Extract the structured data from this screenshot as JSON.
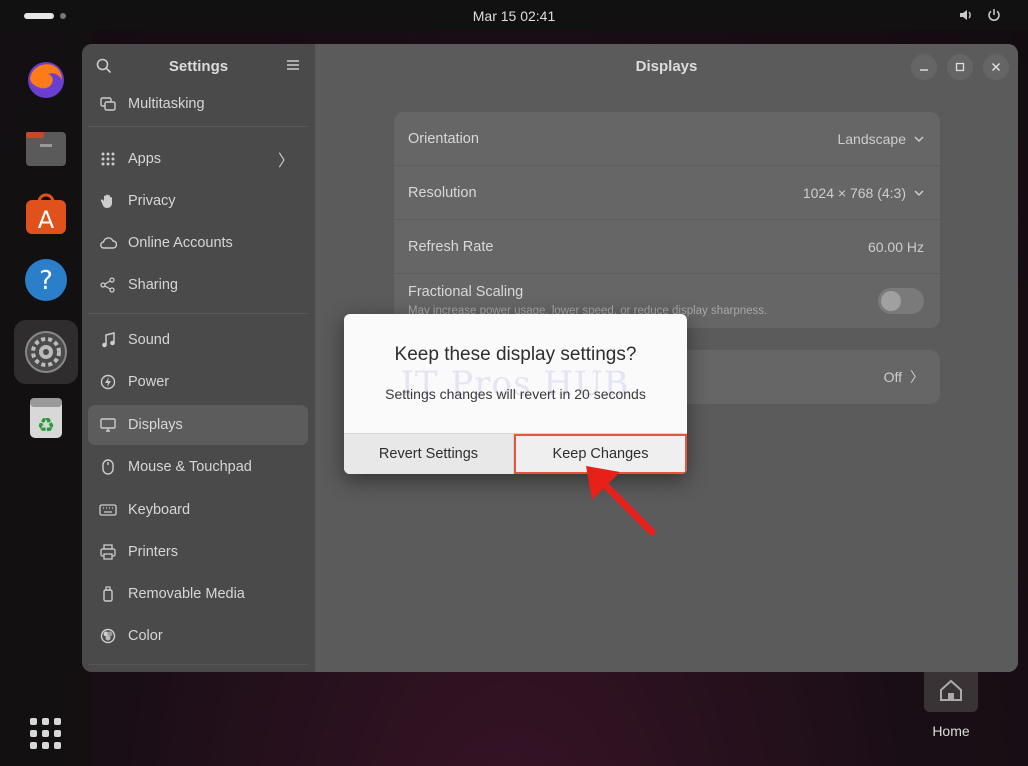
{
  "topbar": {
    "clock": "Mar 15  02:41"
  },
  "dock": {
    "items": [
      {
        "name": "firefox-icon"
      },
      {
        "name": "files-icon"
      },
      {
        "name": "app-center-icon"
      },
      {
        "name": "help-icon"
      },
      {
        "name": "settings-icon",
        "active": true
      },
      {
        "name": "trash-icon"
      }
    ]
  },
  "desktop": {
    "home_label": "Home"
  },
  "window": {
    "sidebar_title": "Settings",
    "title": "Displays"
  },
  "sidebar": {
    "items": [
      {
        "label": "Multitasking",
        "icon": "multitasking-icon"
      },
      {
        "label": "Apps",
        "icon": "apps-icon"
      },
      {
        "label": "Privacy",
        "icon": "hand-icon"
      },
      {
        "label": "Online Accounts",
        "icon": "cloud-icon"
      },
      {
        "label": "Sharing",
        "icon": "share-icon"
      },
      {
        "label": "Sound",
        "icon": "music-note-icon"
      },
      {
        "label": "Power",
        "icon": "power-icon"
      },
      {
        "label": "Displays",
        "icon": "monitor-icon",
        "active": true
      },
      {
        "label": "Mouse & Touchpad",
        "icon": "mouse-icon"
      },
      {
        "label": "Keyboard",
        "icon": "keyboard-icon"
      },
      {
        "label": "Printers",
        "icon": "printer-icon"
      },
      {
        "label": "Removable Media",
        "icon": "usb-icon"
      },
      {
        "label": "Color",
        "icon": "color-icon"
      }
    ]
  },
  "display_settings": {
    "orientation_label": "Orientation",
    "orientation_value": "Landscape",
    "resolution_label": "Resolution",
    "resolution_value": "1024 × 768 (4:3)",
    "refresh_label": "Refresh Rate",
    "refresh_value": "60.00 Hz",
    "scaling_label": "Fractional Scaling",
    "scaling_desc": "May increase power usage, lower speed, or reduce display sharpness.",
    "night_light_value": "Off"
  },
  "dialog": {
    "title": "Keep these display settings?",
    "message": "Settings changes will revert in 20 seconds",
    "watermark": "IT Pros HUB",
    "revert_label": "Revert Settings",
    "keep_label": "Keep Changes"
  },
  "colors": {
    "accent_highlight": "#e2563b",
    "annotation_arrow": "#e8201a"
  }
}
